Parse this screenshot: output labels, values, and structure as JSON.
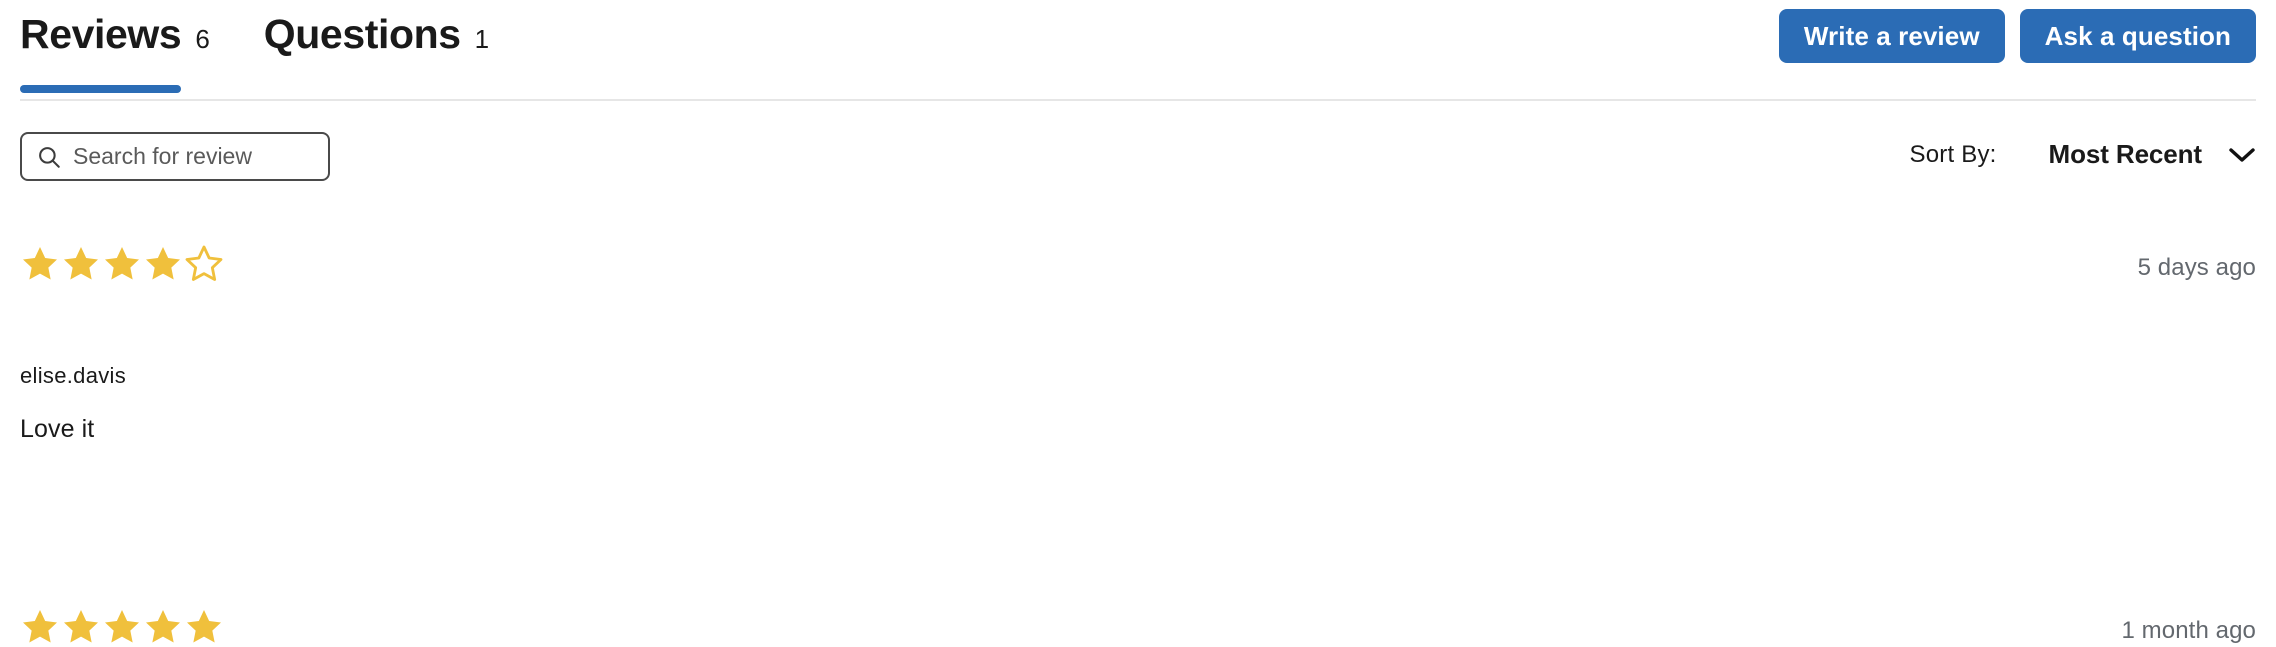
{
  "tabs": [
    {
      "label": "Reviews",
      "count": "6",
      "active": true,
      "name": "tab-reviews"
    },
    {
      "label": "Questions",
      "count": "1",
      "active": false,
      "name": "tab-questions"
    }
  ],
  "header": {
    "write_review_label": "Write a review",
    "ask_question_label": "Ask a question"
  },
  "search": {
    "placeholder": "Search for review",
    "value": "",
    "icon": "search-icon"
  },
  "sort": {
    "label": "Sort By:",
    "value": "Most Recent",
    "icon": "chevron-down-icon"
  },
  "reviews": [
    {
      "rating": 4,
      "max_rating": 5,
      "date": "5 days ago",
      "author": "elise.davis",
      "body": "Love it"
    },
    {
      "rating": 5,
      "max_rating": 5,
      "date": "1 month ago",
      "author": "",
      "body": ""
    }
  ],
  "colors": {
    "accent_blue": "#2b6cb5",
    "star_gold": "#f0c03c",
    "divider": "#e6e6e6",
    "muted_text": "#63686e"
  }
}
